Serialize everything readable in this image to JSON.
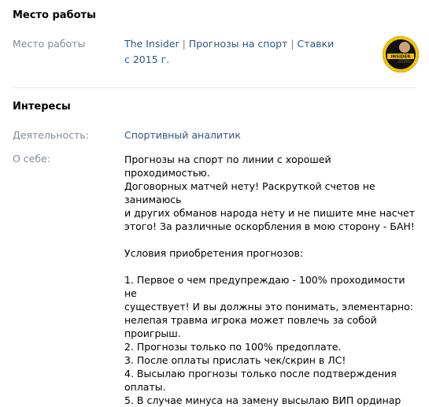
{
  "work": {
    "section_title": "Место работы",
    "label": "Место работы",
    "org_part1": "The Insider",
    "org_part2": "Прогнозы на спорт",
    "org_part3": "Ставки",
    "separator": " | ",
    "since": "с 2015 г.",
    "avatar_text": "INSIDER",
    "accent_color": "#f5c400"
  },
  "interests": {
    "section_title": "Интересы",
    "activity_label": "Деятельность:",
    "activity_value": "Спортивный аналитик",
    "about_label": "О себе:",
    "about_lines": [
      "Прогнозы на спорт по линии с хорошей проходимостью.",
      "Договорных матчей нету! Раскруткой счетов не занимаюсь",
      "и других обманов народа нету и не пишите мне насчет",
      "этого! За различные оскорбления в мою сторону - БАН!",
      "Условия приобретения прогнозов:",
      "1. Первое о чем предупреждаю - 100% проходимости не",
      "существует! И вы должны это понимать, элементарно:",
      "нелепая травма игрока может повлечь за собой проигрыш.",
      "2. Прогнозы только по 100% предоплате.",
      "3. После оплаты прислать чек/скрин в ЛС!",
      "4. Высылаю прогнозы только после подтверждения",
      "оплаты.",
      "5. В случае минуса на замену высылаю ВИП ординар"
    ]
  },
  "colors": {
    "link": "#2a5885",
    "label": "#818c99",
    "divider": "#e7e8ec"
  }
}
